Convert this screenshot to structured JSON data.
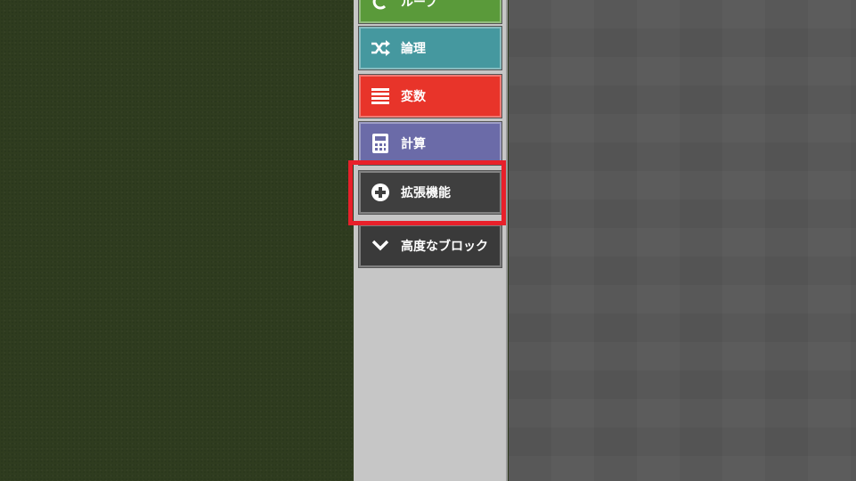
{
  "toolbox": {
    "categories": [
      {
        "label": "ループ",
        "icon": "loop-icon",
        "color": "#5a9a3a"
      },
      {
        "label": "論理",
        "icon": "shuffle-icon",
        "color": "#45989f"
      },
      {
        "label": "変数",
        "icon": "list-icon",
        "color": "#e8342a"
      },
      {
        "label": "計算",
        "icon": "calculator-icon",
        "color": "#6b6ba8"
      },
      {
        "label": "拡張機能",
        "icon": "plus-circle-icon",
        "color": "#3f3f3f"
      },
      {
        "label": "高度なブロック",
        "icon": "chevron-down-icon",
        "color": "#3a3a3a"
      }
    ]
  },
  "highlight": {
    "target": "拡張機能",
    "color": "#e8202a"
  }
}
